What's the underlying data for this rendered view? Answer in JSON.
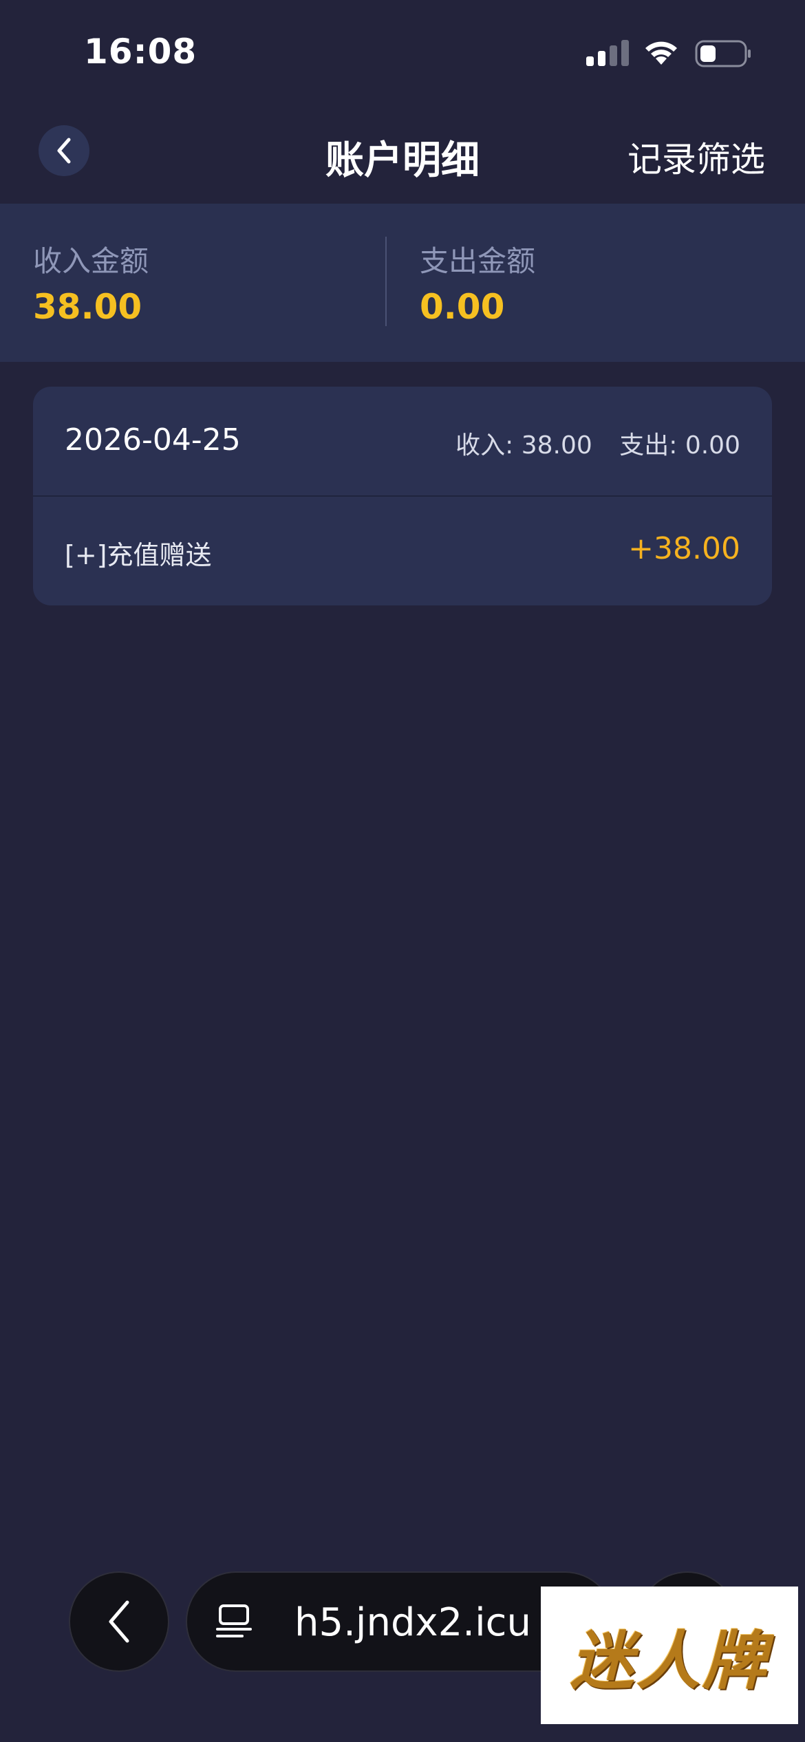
{
  "status_bar": {
    "time": "16:08"
  },
  "nav": {
    "title": "账户明细",
    "filter_label": "记录筛选"
  },
  "summary": {
    "income_label": "收入金额",
    "income_value": "38.00",
    "expense_label": "支出金额",
    "expense_value": "0.00"
  },
  "records": {
    "date": "2026-04-25",
    "income_total": "收入: 38.00",
    "expense_total": "支出: 0.00",
    "item_desc": "[+]充值赠送",
    "item_amount": "+38.00"
  },
  "browser": {
    "url": "h5.jndx2.icu"
  },
  "logo": {
    "text": "迷人牌"
  },
  "colors": {
    "accent": "#f6c021",
    "background": "#23233b",
    "card": "#2b3152"
  }
}
